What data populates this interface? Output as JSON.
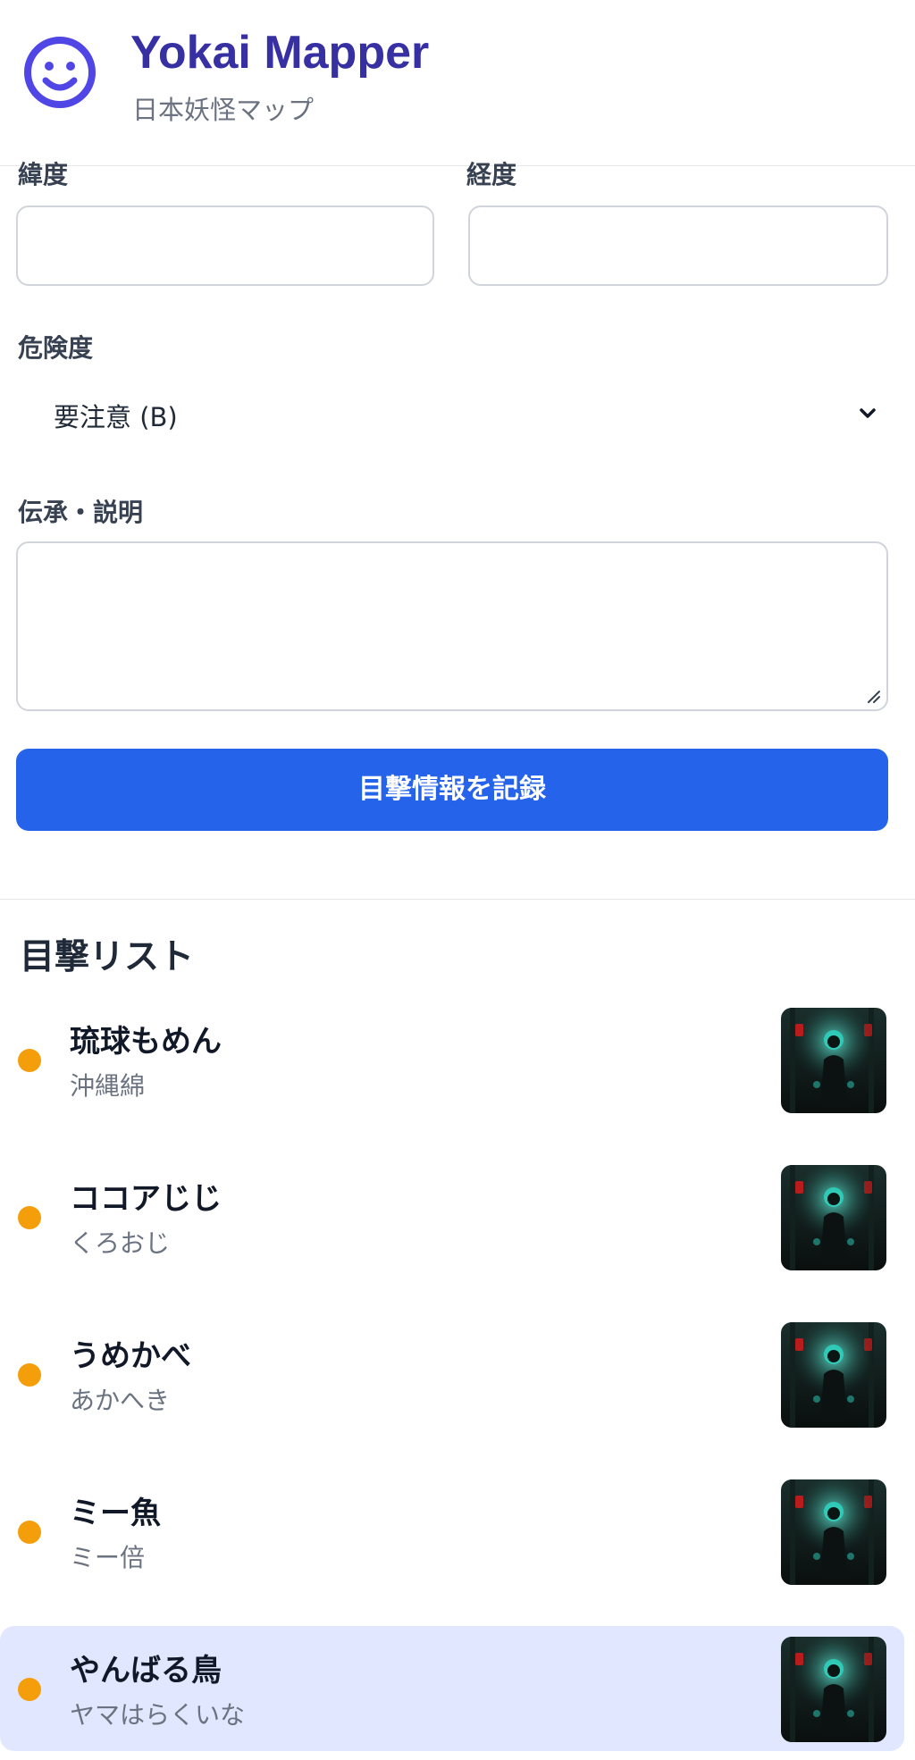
{
  "header": {
    "title": "Yokai Mapper",
    "subtitle": "日本妖怪マップ",
    "logo_icon": "smiley-face-icon",
    "accent_color": "#4f46e5"
  },
  "form": {
    "latitude_label": "緯度",
    "latitude_value": "",
    "longitude_label": "経度",
    "longitude_value": "",
    "danger_label": "危険度",
    "danger_selected": "要注意 (B)",
    "danger_icon": "chevron-down-icon",
    "description_label": "伝承・説明",
    "description_value": "",
    "submit_label": "目撃情報を記録",
    "submit_color": "#2563eb"
  },
  "sightings": {
    "title": "目撃リスト",
    "status_color": "#f59e0b",
    "selected_background": "#e0e7ff",
    "items": [
      {
        "name": "琉球もめん",
        "reading": "沖縄綿",
        "thumb_icon": "yokai-thumbnail-icon"
      },
      {
        "name": "ココアじじ",
        "reading": "くろおじ",
        "thumb_icon": "yokai-thumbnail-icon"
      },
      {
        "name": "うめかべ",
        "reading": "あかへき",
        "thumb_icon": "yokai-thumbnail-icon"
      },
      {
        "name": "ミー魚",
        "reading": "ミー倍",
        "thumb_icon": "yokai-thumbnail-icon"
      },
      {
        "name": "やんばる鳥",
        "reading": "ヤマはらくいな",
        "thumb_icon": "yokai-thumbnail-icon",
        "selected": true
      }
    ]
  }
}
